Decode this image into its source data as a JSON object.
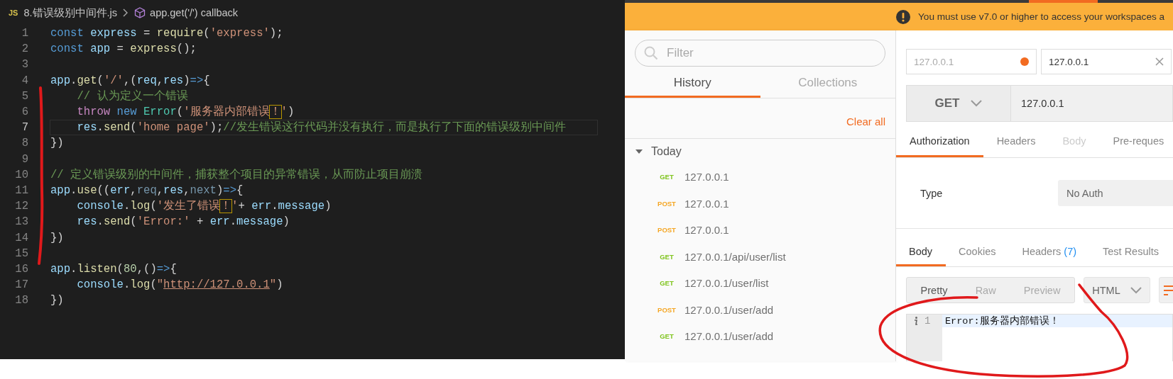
{
  "editor": {
    "breadcrumb": {
      "file_badge": "JS",
      "file": "8.错误级别中间件.js",
      "symbol": "app.get('/') callback"
    },
    "lines": [
      {
        "number": "1",
        "current": false,
        "tokens": [
          {
            "text": "const ",
            "kind": "kw"
          },
          {
            "text": "express",
            "kind": "var"
          },
          {
            "text": " = ",
            "kind": "punct"
          },
          {
            "text": "require",
            "kind": "fn"
          },
          {
            "text": "(",
            "kind": "punct"
          },
          {
            "text": "'express'",
            "kind": "str"
          },
          {
            "text": ");",
            "kind": "punct"
          }
        ]
      },
      {
        "number": "2",
        "current": false,
        "tokens": [
          {
            "text": "const ",
            "kind": "kw"
          },
          {
            "text": "app",
            "kind": "var"
          },
          {
            "text": " = ",
            "kind": "punct"
          },
          {
            "text": "express",
            "kind": "fn"
          },
          {
            "text": "();",
            "kind": "punct"
          }
        ]
      },
      {
        "number": "3",
        "current": false
      },
      {
        "number": "4",
        "current": false,
        "tokens": [
          {
            "text": "app",
            "kind": "var"
          },
          {
            "text": ".",
            "kind": "punct"
          },
          {
            "text": "get",
            "kind": "fn"
          },
          {
            "text": "(",
            "kind": "punct"
          },
          {
            "text": "'/'",
            "kind": "str"
          },
          {
            "text": ",(",
            "kind": "punct"
          },
          {
            "text": "req",
            "kind": "var"
          },
          {
            "text": ",",
            "kind": "punct"
          },
          {
            "text": "res",
            "kind": "var"
          },
          {
            "text": ")",
            "kind": "punct"
          },
          {
            "text": "=>",
            "kind": "kw"
          },
          {
            "text": "{",
            "kind": "punct"
          }
        ]
      },
      {
        "number": "5",
        "current": false,
        "tokens": [
          {
            "text": "    // 认为定义一个错误",
            "kind": "comment"
          }
        ]
      },
      {
        "number": "6",
        "current": false,
        "tokens": [
          {
            "text": "    throw ",
            "kind": "ctrl"
          },
          {
            "text": "new ",
            "kind": "kw"
          },
          {
            "text": "Error",
            "kind": "cls"
          },
          {
            "text": "(",
            "kind": "punct"
          },
          {
            "text": "'服务器内部错误",
            "kind": "str"
          },
          {
            "text": "！",
            "kind": "match"
          },
          {
            "text": "'",
            "kind": "str"
          },
          {
            "text": ")",
            "kind": "punct"
          }
        ]
      },
      {
        "number": "7",
        "current": true,
        "tokens": [
          {
            "text": "    res",
            "kind": "var"
          },
          {
            "text": ".",
            "kind": "punct"
          },
          {
            "text": "send",
            "kind": "fn"
          },
          {
            "text": "(",
            "kind": "punct"
          },
          {
            "text": "'home page'",
            "kind": "str"
          },
          {
            "text": ");",
            "kind": "punct"
          },
          {
            "text": "//发生错误这行代码并没有执行，而是执行了下面的错误级别中间件",
            "kind": "comment"
          }
        ]
      },
      {
        "number": "8",
        "current": false,
        "tokens": [
          {
            "text": "})",
            "kind": "punct"
          }
        ]
      },
      {
        "number": "9",
        "current": false
      },
      {
        "number": "10",
        "current": false,
        "tokens": [
          {
            "text": "// 定义错误级别的中间件，捕获整个项目的异常错误，从而防止项目崩溃",
            "kind": "comment"
          }
        ]
      },
      {
        "number": "11",
        "current": false,
        "tokens": [
          {
            "text": "app",
            "kind": "var"
          },
          {
            "text": ".",
            "kind": "punct"
          },
          {
            "text": "use",
            "kind": "fn"
          },
          {
            "text": "((",
            "kind": "punct"
          },
          {
            "text": "err",
            "kind": "var"
          },
          {
            "text": ",",
            "kind": "punct"
          },
          {
            "text": "req",
            "kind": "unused"
          },
          {
            "text": ",",
            "kind": "punct"
          },
          {
            "text": "res",
            "kind": "var"
          },
          {
            "text": ",",
            "kind": "punct"
          },
          {
            "text": "next",
            "kind": "unused"
          },
          {
            "text": ")",
            "kind": "punct"
          },
          {
            "text": "=>",
            "kind": "kw"
          },
          {
            "text": "{",
            "kind": "punct"
          }
        ]
      },
      {
        "number": "12",
        "current": false,
        "tokens": [
          {
            "text": "    console",
            "kind": "var"
          },
          {
            "text": ".",
            "kind": "punct"
          },
          {
            "text": "log",
            "kind": "fn"
          },
          {
            "text": "(",
            "kind": "punct"
          },
          {
            "text": "'发生了错误",
            "kind": "str"
          },
          {
            "text": "！",
            "kind": "match"
          },
          {
            "text": "'",
            "kind": "str"
          },
          {
            "text": "+ ",
            "kind": "punct"
          },
          {
            "text": "err",
            "kind": "var"
          },
          {
            "text": ".",
            "kind": "punct"
          },
          {
            "text": "message",
            "kind": "var"
          },
          {
            "text": ")",
            "kind": "punct"
          }
        ]
      },
      {
        "number": "13",
        "current": false,
        "tokens": [
          {
            "text": "    res",
            "kind": "var"
          },
          {
            "text": ".",
            "kind": "punct"
          },
          {
            "text": "send",
            "kind": "fn"
          },
          {
            "text": "(",
            "kind": "punct"
          },
          {
            "text": "'Error:'",
            "kind": "str"
          },
          {
            "text": " + ",
            "kind": "punct"
          },
          {
            "text": "err",
            "kind": "var"
          },
          {
            "text": ".",
            "kind": "punct"
          },
          {
            "text": "message",
            "kind": "var"
          },
          {
            "text": ")",
            "kind": "punct"
          }
        ]
      },
      {
        "number": "14",
        "current": false,
        "tokens": [
          {
            "text": "})",
            "kind": "punct"
          }
        ]
      },
      {
        "number": "15",
        "current": false
      },
      {
        "number": "16",
        "current": false,
        "tokens": [
          {
            "text": "app",
            "kind": "var"
          },
          {
            "text": ".",
            "kind": "punct"
          },
          {
            "text": "listen",
            "kind": "fn"
          },
          {
            "text": "(",
            "kind": "punct"
          },
          {
            "text": "80",
            "kind": "num"
          },
          {
            "text": ",()",
            "kind": "punct"
          },
          {
            "text": "=>",
            "kind": "kw"
          },
          {
            "text": "{",
            "kind": "punct"
          }
        ]
      },
      {
        "number": "17",
        "current": false,
        "tokens": [
          {
            "text": "    console",
            "kind": "var"
          },
          {
            "text": ".",
            "kind": "punct"
          },
          {
            "text": "log",
            "kind": "fn"
          },
          {
            "text": "(",
            "kind": "punct"
          },
          {
            "text": "\"",
            "kind": "str"
          },
          {
            "text": "http://127.0.0.1",
            "kind": "link"
          },
          {
            "text": "\"",
            "kind": "str"
          },
          {
            "text": ")",
            "kind": "punct"
          }
        ]
      },
      {
        "number": "18",
        "current": false,
        "tokens": [
          {
            "text": "})",
            "kind": "punct"
          }
        ]
      }
    ]
  },
  "postman": {
    "banner": {
      "text": "You must use v7.0 or higher to access your workspaces a"
    },
    "sidebar": {
      "filter": {
        "placeholder": "Filter"
      },
      "tabs": [
        {
          "label": "History",
          "selected": true
        },
        {
          "label": "Collections",
          "selected": false
        }
      ],
      "clear_all": "Clear all",
      "group": {
        "label": "Today",
        "expanded": true,
        "items": [
          {
            "method": "GET",
            "url": "127.0.0.1"
          },
          {
            "method": "POST",
            "url": "127.0.0.1"
          },
          {
            "method": "POST",
            "url": "127.0.0.1"
          },
          {
            "method": "GET",
            "url": "127.0.0.1/api/user/list"
          },
          {
            "method": "GET",
            "url": "127.0.0.1/user/list"
          },
          {
            "method": "POST",
            "url": "127.0.0.1/user/add"
          },
          {
            "method": "GET",
            "url": "127.0.0.1/user/add"
          }
        ]
      }
    },
    "request_tabs": [
      {
        "label": "127.0.0.1",
        "selected": false,
        "unsaved": true
      },
      {
        "label": "127.0.0.1",
        "selected": true,
        "unsaved": false
      }
    ],
    "request": {
      "method": "GET",
      "url": "127.0.0.1"
    },
    "request_sections": [
      {
        "label": "Authorization",
        "selected": true,
        "disabled": false
      },
      {
        "label": "Headers",
        "selected": false,
        "disabled": false
      },
      {
        "label": "Body",
        "selected": false,
        "disabled": true
      },
      {
        "label": "Pre-reques",
        "selected": false,
        "disabled": false
      }
    ],
    "auth": {
      "label": "Type",
      "value": "No Auth"
    },
    "response_tabs": [
      {
        "label": "Body",
        "selected": true
      },
      {
        "label": "Cookies",
        "selected": false
      },
      {
        "label": "Headers",
        "count": "(7)",
        "selected": false
      },
      {
        "label": "Test Results",
        "selected": false
      }
    ],
    "view_modes": [
      {
        "label": "Pretty",
        "selected": true
      },
      {
        "label": "Raw",
        "selected": false
      },
      {
        "label": "Preview",
        "selected": false
      }
    ],
    "format": "HTML",
    "response_lines": [
      {
        "number": "1",
        "text": "Error:服务器内部错误！"
      }
    ]
  }
}
